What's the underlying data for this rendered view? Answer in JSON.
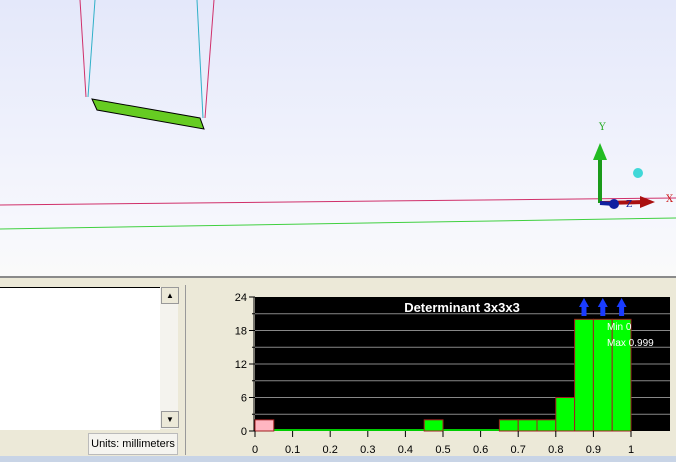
{
  "viewport": {
    "axis_labels": {
      "x": "X",
      "y": "Y",
      "z": "Z"
    }
  },
  "status": {
    "units": "Units: millimeters"
  },
  "scroll": {
    "up": "▲",
    "down": "▼"
  },
  "chart_data": {
    "type": "bar",
    "title": "Determinant 3x3x3",
    "xlim": [
      0,
      1
    ],
    "ylim": [
      0,
      24
    ],
    "xticks": [
      0,
      0.1,
      0.2,
      0.3,
      0.4,
      0.5,
      0.6,
      0.7,
      0.8,
      0.9,
      1
    ],
    "yticks": [
      0,
      6,
      12,
      18,
      24
    ],
    "bin_width": 0.05,
    "bins": [
      {
        "start": 0,
        "value": 2,
        "color": "#ffb6c1"
      },
      {
        "start": 0.45,
        "value": 2,
        "color": "#00ff00"
      },
      {
        "start": 0.65,
        "value": 2,
        "color": "#00ff00"
      },
      {
        "start": 0.7,
        "value": 2,
        "color": "#00ff00"
      },
      {
        "start": 0.75,
        "value": 2,
        "color": "#00ff00"
      },
      {
        "start": 0.8,
        "value": 6,
        "color": "#00ff00"
      },
      {
        "start": 0.85,
        "value": 20,
        "color": "#00ff00",
        "overflow": true
      },
      {
        "start": 0.9,
        "value": 20,
        "color": "#00ff00",
        "overflow": true
      },
      {
        "start": 0.95,
        "value": 20,
        "color": "#00ff00",
        "overflow": true
      }
    ],
    "min_label": "Min 0",
    "max_label": "Max 0.999",
    "grid": true
  }
}
